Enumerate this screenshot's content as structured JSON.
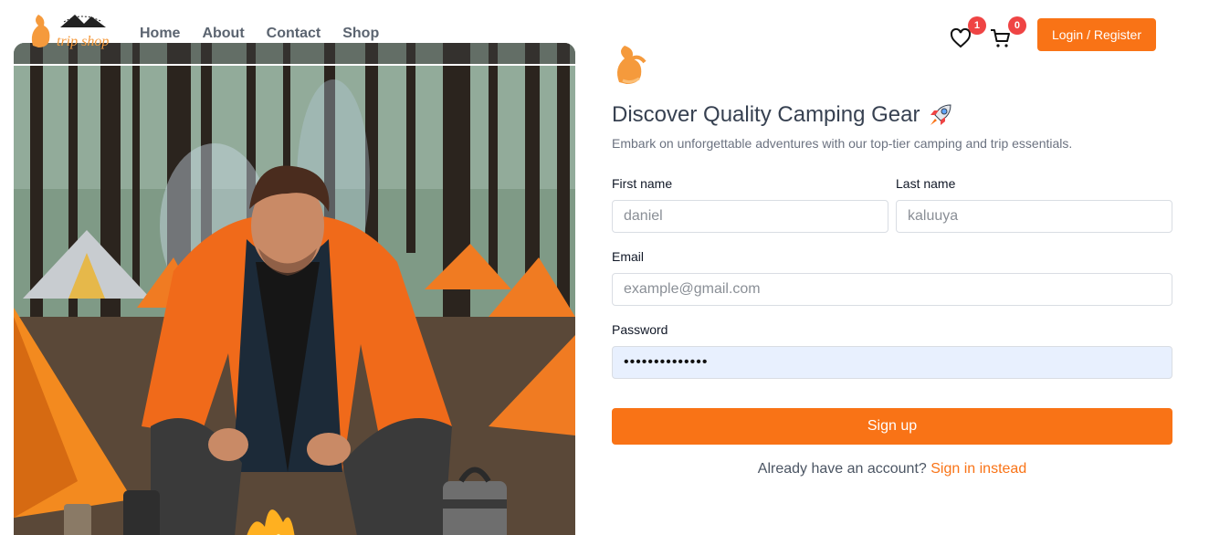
{
  "brand": {
    "logo_text": "trip shop"
  },
  "nav": {
    "items": [
      "Home",
      "About",
      "Contact",
      "Shop"
    ]
  },
  "header": {
    "wishlist_count": "1",
    "cart_count": "0",
    "login_label": "Login / Register"
  },
  "form": {
    "title": "Discover Quality Camping Gear",
    "subtitle": "Embark on unforgettable adventures with our top-tier camping and trip essentials.",
    "first_name": {
      "label": "First name",
      "placeholder": "daniel"
    },
    "last_name": {
      "label": "Last name",
      "placeholder": "kaluuya"
    },
    "email": {
      "label": "Email",
      "placeholder": "example@gmail.com"
    },
    "password": {
      "label": "Password",
      "value": "••••••••••••••"
    },
    "submit_label": "Sign up",
    "signin_prompt": "Already have an account?",
    "signin_link": "Sign in instead"
  },
  "colors": {
    "accent": "#f97316",
    "badge": "#ef4444",
    "autofill": "#e8f0fe"
  }
}
